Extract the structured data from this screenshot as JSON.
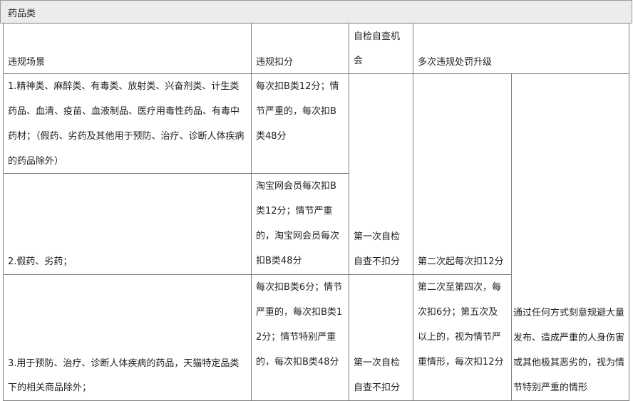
{
  "title": "药品类",
  "headers": {
    "scene": "违规场景",
    "deduction": "违规扣分",
    "self_check": "自检自查机会",
    "upgrade": "多次违规处罚升级"
  },
  "rows": [
    {
      "scene": "1.精神类、麻醉类、有毒类、放射类、兴奋剂类、计生类药品、血清、疫苗、血液制品、医疗用毒性药品、有毒中药材；（假药、劣药及其他用于预防、治疗、诊断人体疾病的药品除外）",
      "deduction": "每次扣B类12分；情节严重的，每次扣B类48分"
    },
    {
      "scene": "2.假药、劣药；",
      "deduction": "淘宝网会员每次扣B类12分；情节严重的，淘宝网会员每次扣B类48分"
    },
    {
      "scene": "3.用于预防、治疗、诊断人体疾病的药品，天猫特定品类下的相关商品除外；",
      "deduction": "每次扣B类6分；情节严重的，每次扣B类12分；情节特别严重的，每次扣B类48分",
      "self_check": "第一次自检自查不扣分",
      "upgrade": "第二次至第四次，每次扣6分；第五次及以上的，视为情节严重情形，每次扣12分"
    }
  ],
  "merged": {
    "self_check_rows_1_2": "第一次自检自查不扣分",
    "upgrade_rows_1_2": "第二次起每次扣12分",
    "special_note": "通过任何方式刻意规避大量发布、造成严重的人身伤害或其他极其恶劣的，视为情节特别严重的情形"
  }
}
